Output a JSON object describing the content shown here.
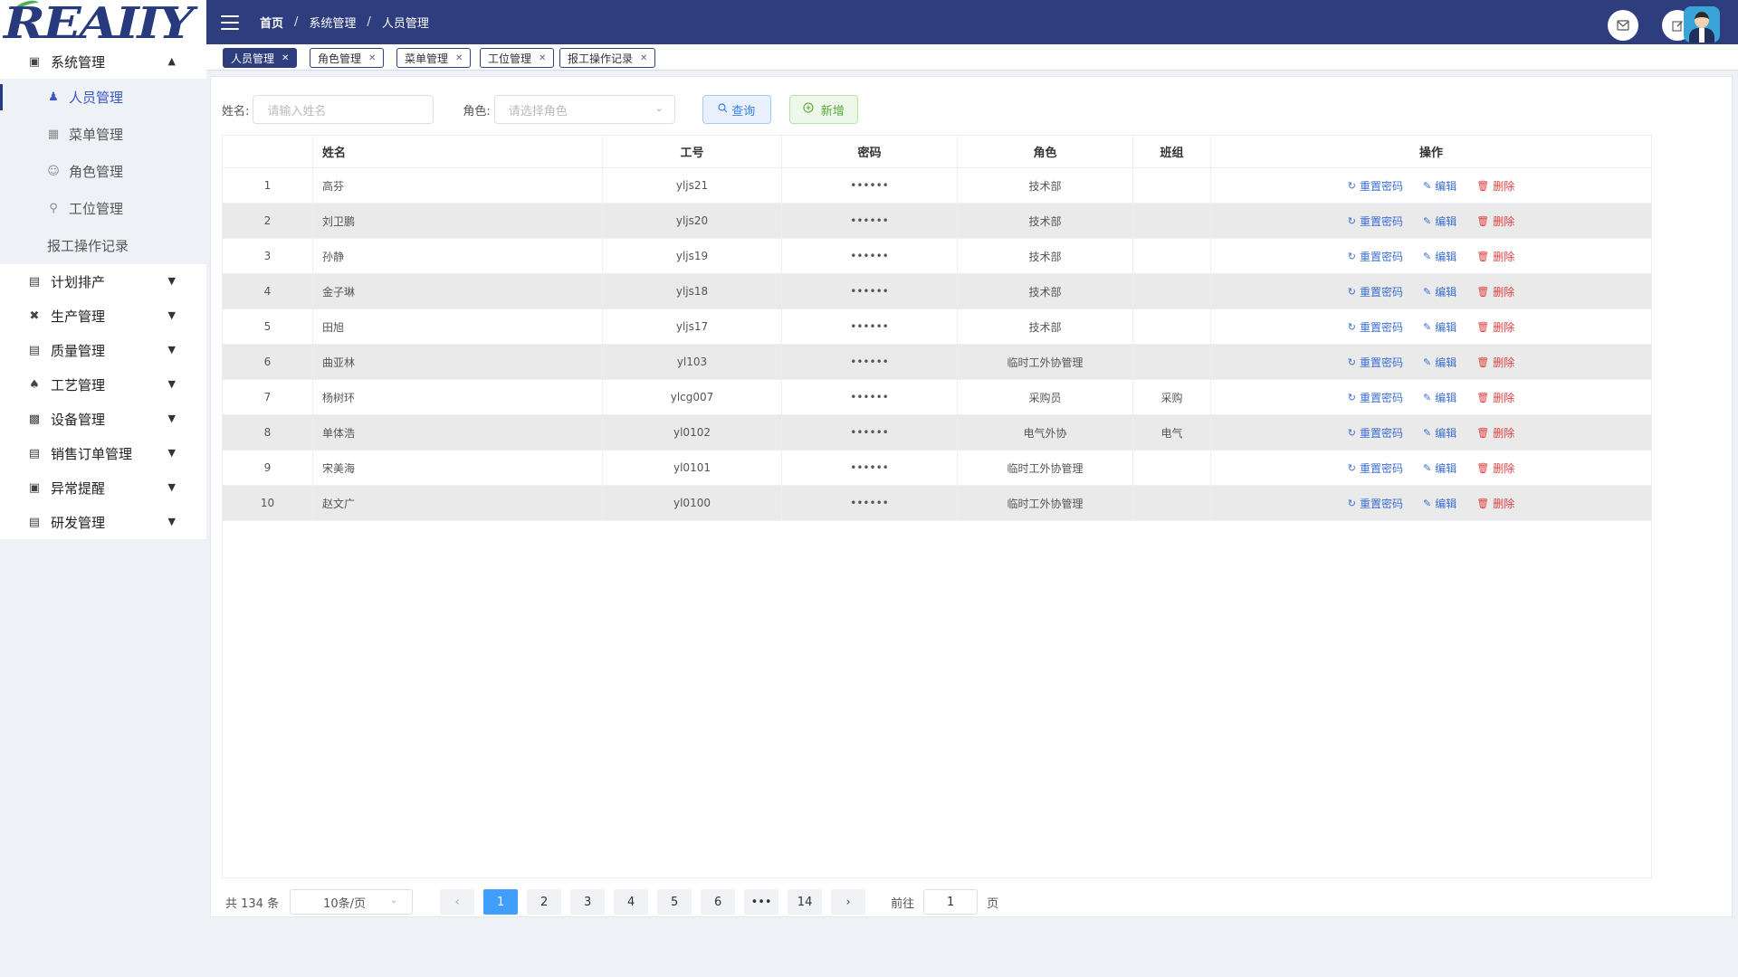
{
  "brand": {
    "logo_text": "REAIIY"
  },
  "header": {
    "breadcrumb": [
      "首页",
      "系统管理",
      "人员管理"
    ],
    "icons": [
      "mail-icon",
      "edit-icon",
      "avatar"
    ]
  },
  "sidebar": {
    "groups": [
      {
        "label": "系统管理",
        "icon": "monitor-icon",
        "expanded": true,
        "children": [
          {
            "label": "人员管理",
            "icon": "user-manage-icon",
            "active": true
          },
          {
            "label": "菜单管理",
            "icon": "grid-icon"
          },
          {
            "label": "角色管理",
            "icon": "user-icon"
          },
          {
            "label": "工位管理",
            "icon": "key-icon"
          },
          {
            "label": "报工操作记录",
            "icon": ""
          }
        ]
      },
      {
        "label": "计划排产",
        "icon": "plan-icon"
      },
      {
        "label": "生产管理",
        "icon": "tools-icon"
      },
      {
        "label": "质量管理",
        "icon": "quality-icon"
      },
      {
        "label": "工艺管理",
        "icon": "process-icon"
      },
      {
        "label": "设备管理",
        "icon": "device-icon"
      },
      {
        "label": "销售订单管理",
        "icon": "order-icon"
      },
      {
        "label": "异常提醒",
        "icon": "alert-icon"
      },
      {
        "label": "研发管理",
        "icon": "rd-icon"
      }
    ]
  },
  "tabs": [
    {
      "label": "人员管理",
      "active": true
    },
    {
      "label": "角色管理"
    },
    {
      "label": "菜单管理"
    },
    {
      "label": "工位管理"
    },
    {
      "label": "报工操作记录"
    }
  ],
  "filter": {
    "name_label": "姓名:",
    "name_placeholder": "请输入姓名",
    "role_label": "角色:",
    "role_placeholder": "请选择角色",
    "query_label": "查询",
    "add_label": "新增"
  },
  "table": {
    "columns": [
      "",
      "姓名",
      "工号",
      "密码",
      "角色",
      "班组",
      "操作"
    ],
    "rows": [
      {
        "idx": "1",
        "name": "高芬",
        "id": "yljs21",
        "pwd": "••••••",
        "role": "技术部",
        "team": ""
      },
      {
        "idx": "2",
        "name": "刘卫鹏",
        "id": "yljs20",
        "pwd": "••••••",
        "role": "技术部",
        "team": ""
      },
      {
        "idx": "3",
        "name": "孙静",
        "id": "yljs19",
        "pwd": "••••••",
        "role": "技术部",
        "team": ""
      },
      {
        "idx": "4",
        "name": "金子琳",
        "id": "yljs18",
        "pwd": "••••••",
        "role": "技术部",
        "team": ""
      },
      {
        "idx": "5",
        "name": "田旭",
        "id": "yljs17",
        "pwd": "••••••",
        "role": "技术部",
        "team": ""
      },
      {
        "idx": "6",
        "name": "曲亚林",
        "id": "yl103",
        "pwd": "••••••",
        "role": "临时工外协管理",
        "team": ""
      },
      {
        "idx": "7",
        "name": "杨树环",
        "id": "ylcg007",
        "pwd": "••••••",
        "role": "采购员",
        "team": "采购"
      },
      {
        "idx": "8",
        "name": "单体浩",
        "id": "yl0102",
        "pwd": "••••••",
        "role": "电气外协",
        "team": "电气"
      },
      {
        "idx": "9",
        "name": "宋美海",
        "id": "yl0101",
        "pwd": "••••••",
        "role": "临时工外协管理",
        "team": ""
      },
      {
        "idx": "10",
        "name": "赵文广",
        "id": "yl0100",
        "pwd": "••••••",
        "role": "临时工外协管理",
        "team": ""
      }
    ],
    "actions": {
      "reset": "重置密码",
      "edit": "编辑",
      "delete": "删除"
    }
  },
  "pagination": {
    "total_text": "共 134 条",
    "page_size": "10条/页",
    "pages": [
      "1",
      "2",
      "3",
      "4",
      "5",
      "6",
      "•••",
      "14"
    ],
    "current": "1",
    "goto_label": "前往",
    "goto_value": "1",
    "page_suffix": "页"
  },
  "colors": {
    "primary": "#2d3d7e",
    "accent": "#409eff",
    "danger": "#e04040",
    "success": "#5aaa3a"
  }
}
